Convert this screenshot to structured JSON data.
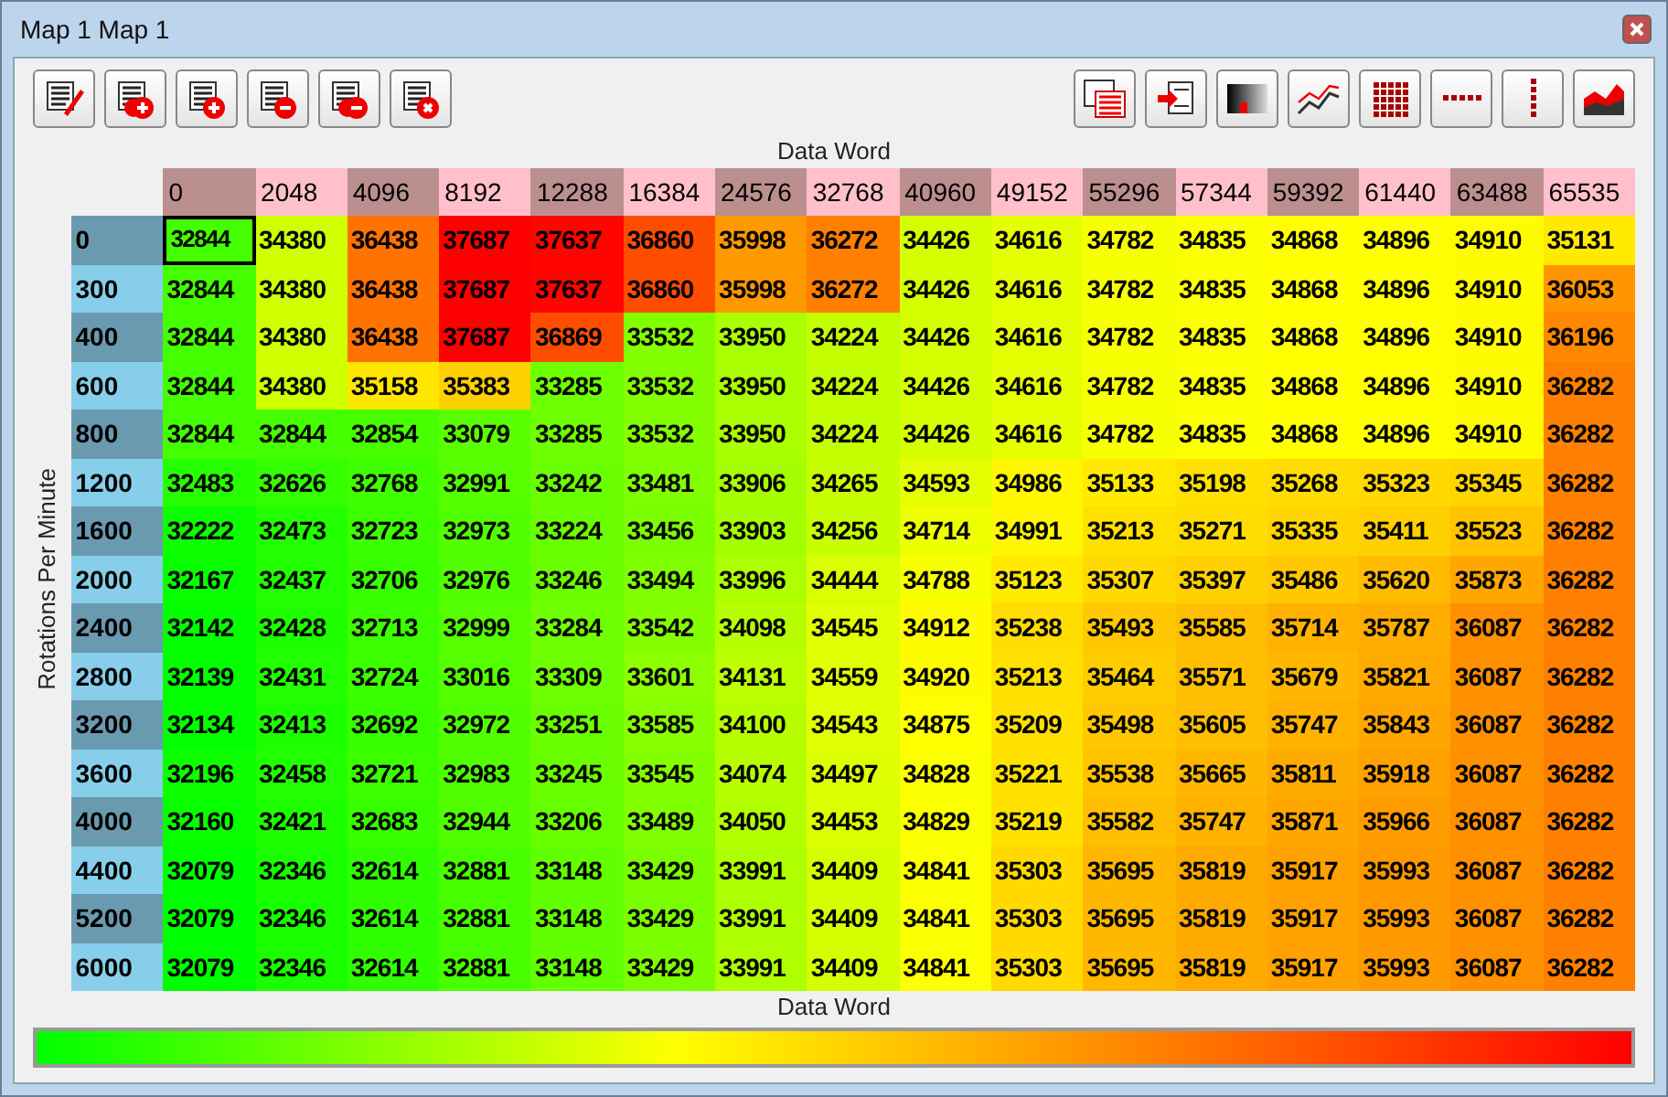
{
  "window": {
    "title": "Map 1 Map 1"
  },
  "toolbar_left": [
    {
      "kind": "edit"
    },
    {
      "kind": "add-multi"
    },
    {
      "kind": "add"
    },
    {
      "kind": "remove"
    },
    {
      "kind": "remove-multi"
    },
    {
      "kind": "delete"
    }
  ],
  "toolbar_right": [
    {
      "kind": "list"
    },
    {
      "kind": "import"
    },
    {
      "kind": "gradient"
    },
    {
      "kind": "line-chart"
    },
    {
      "kind": "grid"
    },
    {
      "kind": "row"
    },
    {
      "kind": "column"
    },
    {
      "kind": "area-chart"
    }
  ],
  "table": {
    "x_title": "Data Word",
    "y_title": "Rotations Per Minute",
    "columns": [
      "0",
      "2048",
      "4096",
      "8192",
      "12288",
      "16384",
      "24576",
      "32768",
      "40960",
      "49152",
      "55296",
      "57344",
      "59392",
      "61440",
      "63488",
      "65535"
    ],
    "rows": [
      {
        "label": "0",
        "cells": [
          {
            "value": "32844",
            "selected": true
          },
          {
            "value": "34380",
            "selected": false
          },
          {
            "value": "36438",
            "selected": false
          },
          {
            "value": "37687",
            "selected": false
          },
          {
            "value": "37637",
            "selected": false
          },
          {
            "value": "36860",
            "selected": false
          },
          {
            "value": "35998",
            "selected": false
          },
          {
            "value": "36272",
            "selected": false
          },
          {
            "value": "34426",
            "selected": false
          },
          {
            "value": "34616",
            "selected": false
          },
          {
            "value": "34782",
            "selected": false
          },
          {
            "value": "34835",
            "selected": false
          },
          {
            "value": "34868",
            "selected": false
          },
          {
            "value": "34896",
            "selected": false
          },
          {
            "value": "34910",
            "selected": false
          },
          {
            "value": "35131",
            "selected": false
          }
        ]
      },
      {
        "label": "300",
        "cells": [
          {
            "value": "32844",
            "selected": false
          },
          {
            "value": "34380",
            "selected": false
          },
          {
            "value": "36438",
            "selected": false
          },
          {
            "value": "37687",
            "selected": false
          },
          {
            "value": "37637",
            "selected": false
          },
          {
            "value": "36860",
            "selected": false
          },
          {
            "value": "35998",
            "selected": false
          },
          {
            "value": "36272",
            "selected": false
          },
          {
            "value": "34426",
            "selected": false
          },
          {
            "value": "34616",
            "selected": false
          },
          {
            "value": "34782",
            "selected": false
          },
          {
            "value": "34835",
            "selected": false
          },
          {
            "value": "34868",
            "selected": false
          },
          {
            "value": "34896",
            "selected": false
          },
          {
            "value": "34910",
            "selected": false
          },
          {
            "value": "36053",
            "selected": false
          }
        ]
      },
      {
        "label": "400",
        "cells": [
          {
            "value": "32844",
            "selected": false
          },
          {
            "value": "34380",
            "selected": false
          },
          {
            "value": "36438",
            "selected": false
          },
          {
            "value": "37687",
            "selected": false
          },
          {
            "value": "36869",
            "selected": false
          },
          {
            "value": "33532",
            "selected": false
          },
          {
            "value": "33950",
            "selected": false
          },
          {
            "value": "34224",
            "selected": false
          },
          {
            "value": "34426",
            "selected": false
          },
          {
            "value": "34616",
            "selected": false
          },
          {
            "value": "34782",
            "selected": false
          },
          {
            "value": "34835",
            "selected": false
          },
          {
            "value": "34868",
            "selected": false
          },
          {
            "value": "34896",
            "selected": false
          },
          {
            "value": "34910",
            "selected": false
          },
          {
            "value": "36196",
            "selected": false
          }
        ]
      },
      {
        "label": "600",
        "cells": [
          {
            "value": "32844",
            "selected": false
          },
          {
            "value": "34380",
            "selected": false
          },
          {
            "value": "35158",
            "selected": false
          },
          {
            "value": "35383",
            "selected": false
          },
          {
            "value": "33285",
            "selected": false
          },
          {
            "value": "33532",
            "selected": false
          },
          {
            "value": "33950",
            "selected": false
          },
          {
            "value": "34224",
            "selected": false
          },
          {
            "value": "34426",
            "selected": false
          },
          {
            "value": "34616",
            "selected": false
          },
          {
            "value": "34782",
            "selected": false
          },
          {
            "value": "34835",
            "selected": false
          },
          {
            "value": "34868",
            "selected": false
          },
          {
            "value": "34896",
            "selected": false
          },
          {
            "value": "34910",
            "selected": false
          },
          {
            "value": "36282",
            "selected": false
          }
        ]
      },
      {
        "label": "800",
        "cells": [
          {
            "value": "32844",
            "selected": false
          },
          {
            "value": "32844",
            "selected": false
          },
          {
            "value": "32854",
            "selected": false
          },
          {
            "value": "33079",
            "selected": false
          },
          {
            "value": "33285",
            "selected": false
          },
          {
            "value": "33532",
            "selected": false
          },
          {
            "value": "33950",
            "selected": false
          },
          {
            "value": "34224",
            "selected": false
          },
          {
            "value": "34426",
            "selected": false
          },
          {
            "value": "34616",
            "selected": false
          },
          {
            "value": "34782",
            "selected": false
          },
          {
            "value": "34835",
            "selected": false
          },
          {
            "value": "34868",
            "selected": false
          },
          {
            "value": "34896",
            "selected": false
          },
          {
            "value": "34910",
            "selected": false
          },
          {
            "value": "36282",
            "selected": false
          }
        ]
      },
      {
        "label": "1200",
        "cells": [
          {
            "value": "32483",
            "selected": false
          },
          {
            "value": "32626",
            "selected": false
          },
          {
            "value": "32768",
            "selected": false
          },
          {
            "value": "32991",
            "selected": false
          },
          {
            "value": "33242",
            "selected": false
          },
          {
            "value": "33481",
            "selected": false
          },
          {
            "value": "33906",
            "selected": false
          },
          {
            "value": "34265",
            "selected": false
          },
          {
            "value": "34593",
            "selected": false
          },
          {
            "value": "34986",
            "selected": false
          },
          {
            "value": "35133",
            "selected": false
          },
          {
            "value": "35198",
            "selected": false
          },
          {
            "value": "35268",
            "selected": false
          },
          {
            "value": "35323",
            "selected": false
          },
          {
            "value": "35345",
            "selected": false
          },
          {
            "value": "36282",
            "selected": false
          }
        ]
      },
      {
        "label": "1600",
        "cells": [
          {
            "value": "32222",
            "selected": false
          },
          {
            "value": "32473",
            "selected": false
          },
          {
            "value": "32723",
            "selected": false
          },
          {
            "value": "32973",
            "selected": false
          },
          {
            "value": "33224",
            "selected": false
          },
          {
            "value": "33456",
            "selected": false
          },
          {
            "value": "33903",
            "selected": false
          },
          {
            "value": "34256",
            "selected": false
          },
          {
            "value": "34714",
            "selected": false
          },
          {
            "value": "34991",
            "selected": false
          },
          {
            "value": "35213",
            "selected": false
          },
          {
            "value": "35271",
            "selected": false
          },
          {
            "value": "35335",
            "selected": false
          },
          {
            "value": "35411",
            "selected": false
          },
          {
            "value": "35523",
            "selected": false
          },
          {
            "value": "36282",
            "selected": false
          }
        ]
      },
      {
        "label": "2000",
        "cells": [
          {
            "value": "32167",
            "selected": false
          },
          {
            "value": "32437",
            "selected": false
          },
          {
            "value": "32706",
            "selected": false
          },
          {
            "value": "32976",
            "selected": false
          },
          {
            "value": "33246",
            "selected": false
          },
          {
            "value": "33494",
            "selected": false
          },
          {
            "value": "33996",
            "selected": false
          },
          {
            "value": "34444",
            "selected": false
          },
          {
            "value": "34788",
            "selected": false
          },
          {
            "value": "35123",
            "selected": false
          },
          {
            "value": "35307",
            "selected": false
          },
          {
            "value": "35397",
            "selected": false
          },
          {
            "value": "35486",
            "selected": false
          },
          {
            "value": "35620",
            "selected": false
          },
          {
            "value": "35873",
            "selected": false
          },
          {
            "value": "36282",
            "selected": false
          }
        ]
      },
      {
        "label": "2400",
        "cells": [
          {
            "value": "32142",
            "selected": false
          },
          {
            "value": "32428",
            "selected": false
          },
          {
            "value": "32713",
            "selected": false
          },
          {
            "value": "32999",
            "selected": false
          },
          {
            "value": "33284",
            "selected": false
          },
          {
            "value": "33542",
            "selected": false
          },
          {
            "value": "34098",
            "selected": false
          },
          {
            "value": "34545",
            "selected": false
          },
          {
            "value": "34912",
            "selected": false
          },
          {
            "value": "35238",
            "selected": false
          },
          {
            "value": "35493",
            "selected": false
          },
          {
            "value": "35585",
            "selected": false
          },
          {
            "value": "35714",
            "selected": false
          },
          {
            "value": "35787",
            "selected": false
          },
          {
            "value": "36087",
            "selected": false
          },
          {
            "value": "36282",
            "selected": false
          }
        ]
      },
      {
        "label": "2800",
        "cells": [
          {
            "value": "32139",
            "selected": false
          },
          {
            "value": "32431",
            "selected": false
          },
          {
            "value": "32724",
            "selected": false
          },
          {
            "value": "33016",
            "selected": false
          },
          {
            "value": "33309",
            "selected": false
          },
          {
            "value": "33601",
            "selected": false
          },
          {
            "value": "34131",
            "selected": false
          },
          {
            "value": "34559",
            "selected": false
          },
          {
            "value": "34920",
            "selected": false
          },
          {
            "value": "35213",
            "selected": false
          },
          {
            "value": "35464",
            "selected": false
          },
          {
            "value": "35571",
            "selected": false
          },
          {
            "value": "35679",
            "selected": false
          },
          {
            "value": "35821",
            "selected": false
          },
          {
            "value": "36087",
            "selected": false
          },
          {
            "value": "36282",
            "selected": false
          }
        ]
      },
      {
        "label": "3200",
        "cells": [
          {
            "value": "32134",
            "selected": false
          },
          {
            "value": "32413",
            "selected": false
          },
          {
            "value": "32692",
            "selected": false
          },
          {
            "value": "32972",
            "selected": false
          },
          {
            "value": "33251",
            "selected": false
          },
          {
            "value": "33585",
            "selected": false
          },
          {
            "value": "34100",
            "selected": false
          },
          {
            "value": "34543",
            "selected": false
          },
          {
            "value": "34875",
            "selected": false
          },
          {
            "value": "35209",
            "selected": false
          },
          {
            "value": "35498",
            "selected": false
          },
          {
            "value": "35605",
            "selected": false
          },
          {
            "value": "35747",
            "selected": false
          },
          {
            "value": "35843",
            "selected": false
          },
          {
            "value": "36087",
            "selected": false
          },
          {
            "value": "36282",
            "selected": false
          }
        ]
      },
      {
        "label": "3600",
        "cells": [
          {
            "value": "32196",
            "selected": false
          },
          {
            "value": "32458",
            "selected": false
          },
          {
            "value": "32721",
            "selected": false
          },
          {
            "value": "32983",
            "selected": false
          },
          {
            "value": "33245",
            "selected": false
          },
          {
            "value": "33545",
            "selected": false
          },
          {
            "value": "34074",
            "selected": false
          },
          {
            "value": "34497",
            "selected": false
          },
          {
            "value": "34828",
            "selected": false
          },
          {
            "value": "35221",
            "selected": false
          },
          {
            "value": "35538",
            "selected": false
          },
          {
            "value": "35665",
            "selected": false
          },
          {
            "value": "35811",
            "selected": false
          },
          {
            "value": "35918",
            "selected": false
          },
          {
            "value": "36087",
            "selected": false
          },
          {
            "value": "36282",
            "selected": false
          }
        ]
      },
      {
        "label": "4000",
        "cells": [
          {
            "value": "32160",
            "selected": false
          },
          {
            "value": "32421",
            "selected": false
          },
          {
            "value": "32683",
            "selected": false
          },
          {
            "value": "32944",
            "selected": false
          },
          {
            "value": "33206",
            "selected": false
          },
          {
            "value": "33489",
            "selected": false
          },
          {
            "value": "34050",
            "selected": false
          },
          {
            "value": "34453",
            "selected": false
          },
          {
            "value": "34829",
            "selected": false
          },
          {
            "value": "35219",
            "selected": false
          },
          {
            "value": "35582",
            "selected": false
          },
          {
            "value": "35747",
            "selected": false
          },
          {
            "value": "35871",
            "selected": false
          },
          {
            "value": "35966",
            "selected": false
          },
          {
            "value": "36087",
            "selected": false
          },
          {
            "value": "36282",
            "selected": false
          }
        ]
      },
      {
        "label": "4400",
        "cells": [
          {
            "value": "32079",
            "selected": false
          },
          {
            "value": "32346",
            "selected": false
          },
          {
            "value": "32614",
            "selected": false
          },
          {
            "value": "32881",
            "selected": false
          },
          {
            "value": "33148",
            "selected": false
          },
          {
            "value": "33429",
            "selected": false
          },
          {
            "value": "33991",
            "selected": false
          },
          {
            "value": "34409",
            "selected": false
          },
          {
            "value": "34841",
            "selected": false
          },
          {
            "value": "35303",
            "selected": false
          },
          {
            "value": "35695",
            "selected": false
          },
          {
            "value": "35819",
            "selected": false
          },
          {
            "value": "35917",
            "selected": false
          },
          {
            "value": "35993",
            "selected": false
          },
          {
            "value": "36087",
            "selected": false
          },
          {
            "value": "36282",
            "selected": false
          }
        ]
      },
      {
        "label": "5200",
        "cells": [
          {
            "value": "32079",
            "selected": false
          },
          {
            "value": "32346",
            "selected": false
          },
          {
            "value": "32614",
            "selected": false
          },
          {
            "value": "32881",
            "selected": false
          },
          {
            "value": "33148",
            "selected": false
          },
          {
            "value": "33429",
            "selected": false
          },
          {
            "value": "33991",
            "selected": false
          },
          {
            "value": "34409",
            "selected": false
          },
          {
            "value": "34841",
            "selected": false
          },
          {
            "value": "35303",
            "selected": false
          },
          {
            "value": "35695",
            "selected": false
          },
          {
            "value": "35819",
            "selected": false
          },
          {
            "value": "35917",
            "selected": false
          },
          {
            "value": "35993",
            "selected": false
          },
          {
            "value": "36087",
            "selected": false
          },
          {
            "value": "36282",
            "selected": false
          }
        ]
      },
      {
        "label": "6000",
        "cells": [
          {
            "value": "32079",
            "selected": false
          },
          {
            "value": "32346",
            "selected": false
          },
          {
            "value": "32614",
            "selected": false
          },
          {
            "value": "32881",
            "selected": false
          },
          {
            "value": "33148",
            "selected": false
          },
          {
            "value": "33429",
            "selected": false
          },
          {
            "value": "33991",
            "selected": false
          },
          {
            "value": "34409",
            "selected": false
          },
          {
            "value": "34841",
            "selected": false
          },
          {
            "value": "35303",
            "selected": false
          },
          {
            "value": "35695",
            "selected": false
          },
          {
            "value": "35819",
            "selected": false
          },
          {
            "value": "35917",
            "selected": false
          },
          {
            "value": "35993",
            "selected": false
          },
          {
            "value": "36087",
            "selected": false
          },
          {
            "value": "36282",
            "selected": false
          }
        ]
      }
    ]
  },
  "legend": {
    "title": "Data Word"
  }
}
